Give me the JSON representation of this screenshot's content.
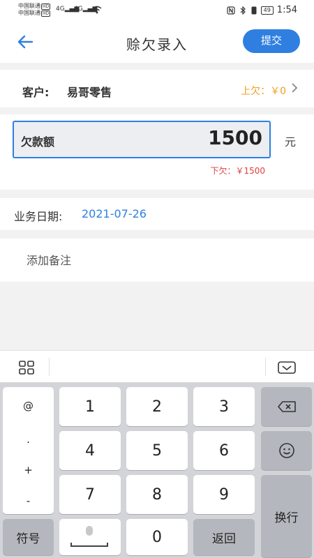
{
  "status_bar": {
    "carrier1": "中国联通",
    "carrier2": "中国联通",
    "hd": "HD",
    "net1": "4G",
    "net2": "4G",
    "battery": "49",
    "time": "1:54"
  },
  "header": {
    "title": "赊欠录入",
    "submit_label": "提交",
    "back_icon": "arrow-left-icon"
  },
  "customer": {
    "label": "客户:",
    "name": "易哥零售",
    "owed": "上欠：￥0"
  },
  "amount": {
    "label": "欠款额",
    "value": "1500",
    "unit": "元",
    "after_owed": "下欠：￥1500"
  },
  "date": {
    "label": "业务日期:",
    "value": "2021-07-26"
  },
  "remark": {
    "placeholder": "添加备注"
  },
  "keyboard": {
    "symbols": [
      "@",
      ".",
      "+",
      "-"
    ],
    "digits": [
      "1",
      "2",
      "3",
      "4",
      "5",
      "6",
      "7",
      "8",
      "9",
      "0"
    ],
    "symbol_switch": "符号",
    "back_label": "返回",
    "enter_label": "换行"
  },
  "colors": {
    "accent": "#2f7fe0",
    "owed": "#f0a020",
    "after_owed": "#e03c3c"
  }
}
